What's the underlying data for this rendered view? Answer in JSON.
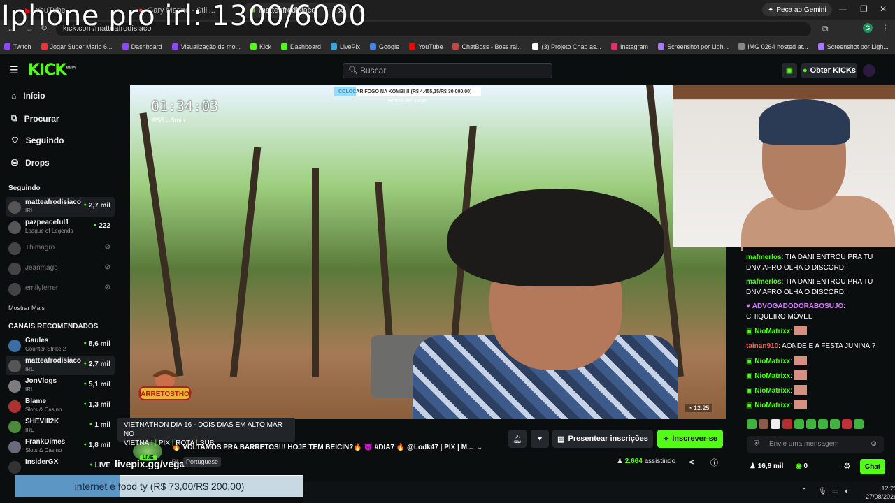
{
  "overlay": {
    "title": "Iphone pro irl: 1300/6000"
  },
  "browser": {
    "tabs": [
      {
        "label": "YouTube"
      },
      {
        "label": "Gary Marine - Still..."
      },
      {
        "label": "matteafrodisiaco"
      }
    ],
    "url": "kick.com/matteafrodisiaco",
    "gemini_label": "Peça ao Gemini",
    "bookmarks": [
      "Twitch",
      "Jogar Super Mario 6...",
      "Dashboard",
      "Visualização de mo...",
      "Kick",
      "Dashboard",
      "LivePix",
      "Google",
      "YouTube",
      "ChatBoss - Boss rai...",
      "(3) Projeto Chad as...",
      "Instagram",
      "Screenshot por Ligh...",
      "IMG 0264 hosted at...",
      "Screenshot por Ligh..."
    ]
  },
  "header": {
    "logo": "KICK",
    "logo_beta": "BETA",
    "search_placeholder": "Buscar",
    "obter_label": "Obter KICKs"
  },
  "sidebar": {
    "nav": [
      {
        "label": "Início"
      },
      {
        "label": "Procurar"
      },
      {
        "label": "Seguindo"
      },
      {
        "label": "Drops"
      }
    ],
    "following_header": "Seguindo",
    "following": [
      {
        "name": "matteafrodisiaco",
        "category": "IRL",
        "viewers": "2,7 mil"
      },
      {
        "name": "pazpeaceful1",
        "category": "League of Legends",
        "viewers": "222"
      },
      {
        "name": "Thimagro"
      },
      {
        "name": "Jeanmago"
      },
      {
        "name": "emilyferrer"
      }
    ],
    "show_more": "Mostrar Mais",
    "recommended_header": "CANAIS RECOMENDADOS",
    "recommended": [
      {
        "name": "Gaules",
        "category": "Counter-Strike 2",
        "viewers": "8,6 mil"
      },
      {
        "name": "matteafrodisiaco",
        "category": "IRL",
        "viewers": "2,7 mil"
      },
      {
        "name": "JonVlogs",
        "category": "IRL",
        "viewers": "5,1 mil"
      },
      {
        "name": "Blame",
        "category": "Slots & Casino",
        "viewers": "1,3 mil"
      },
      {
        "name": "SHEVIII2K",
        "category": "IRL",
        "viewers": "1 mil"
      },
      {
        "name": "FrankDimes",
        "category": "Slots & Casino",
        "viewers": "1,8 mil"
      },
      {
        "name": "InsiderGX",
        "viewers": "LIVE"
      }
    ]
  },
  "video": {
    "timer": "01:34:03",
    "timer_sub": "R$5 = 5min",
    "goal": "COLOCAR FOGO NA KOMBI !! (R$ 4.455,15/R$ 30.000,00)",
    "goal_progress": 0.1485,
    "goal_sub": "Termina em 3 dias",
    "time": "12:25",
    "logo_text": "BARRETOSTHON"
  },
  "chat": {
    "messages": [
      {
        "user": "mafmerlos",
        "color": "#53fc18",
        "text": "TIA DANI ENTROU PRA TU DNV AFRO OLHA O DISCORD!"
      },
      {
        "user": "mafmerlos",
        "color": "#53fc18",
        "text": "TIA DANI ENTROU PRA TU DNV AFRO OLHA O DISCORD!"
      },
      {
        "user": "ADVOGADODORABOSUJO",
        "color": "#d77bff",
        "text": "CHIQUEIRO MÓVEL"
      },
      {
        "user": "NioMatrixx",
        "color": "#53fc18",
        "text": ""
      },
      {
        "user": "tainan910",
        "color": "#ff5a5a",
        "text": "AONDE E A FESTA JUNINA ?"
      },
      {
        "user": "NioMatrixx",
        "color": "#53fc18",
        "text": ""
      },
      {
        "user": "NioMatrixx",
        "color": "#53fc18",
        "text": ""
      },
      {
        "user": "NioMatrixx",
        "color": "#53fc18",
        "text": ""
      },
      {
        "user": "NioMatrixx",
        "color": "#53fc18",
        "text": ""
      }
    ],
    "input_placeholder": "Envie uma mensagem",
    "followers": "16,8 mil",
    "kicks": "0",
    "send_label": "Chat"
  },
  "stream": {
    "tooltip_line1": "VIETNÃTHON DIA 16 - DOIS DIAS EM ALTO MAR NO",
    "tooltip_line2_a": "VIETNÃ!!",
    "tooltip_pix": "PIX",
    "tooltip_rota": "ROTA",
    "tooltip_sub": "SUB",
    "title": "🔥 VOLTAMOS PRA BARRETOS!!! HOJE TEM BEICIN?🔥 😈 #DIA7 🔥 @Lodk47 | PIX | M...",
    "live": "LIVE",
    "livepix": "livepix.gg/vegano",
    "category": "IRL",
    "language": "Portuguese",
    "gift_label": "Presentear inscrições",
    "sub_label": "Inscrever-se",
    "viewers": "2.664",
    "viewers_label": "assistindo"
  },
  "donation": {
    "text": "internet e food ty (R$ 73,00/R$ 200,00)",
    "progress": 0.365
  },
  "taskbar": {
    "time": "12:25",
    "date": "27/08/2026"
  }
}
